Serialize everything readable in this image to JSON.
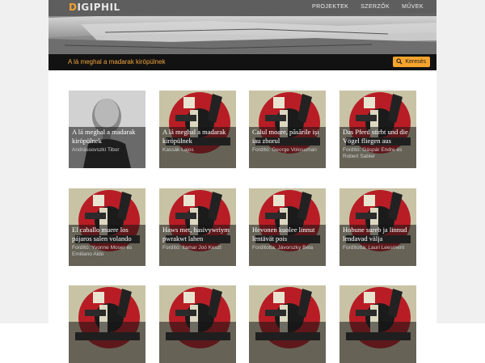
{
  "header": {
    "logo_accent": "D",
    "logo_rest": "IGIPHIL",
    "nav": [
      "PROJEKTEK",
      "SZERZŐK",
      "MŰVEK"
    ]
  },
  "titlebar": {
    "title": "A lá meghal a madarak kiröpülnek",
    "search_label": "Keresés"
  },
  "cards": [
    {
      "title": "A lá meghal a madarak kiröpülnek",
      "author": "Andrássovszkí Tibor",
      "image": "portrait-photo"
    },
    {
      "title": "A lá meghal a madarak kiröpülnek",
      "author": "Kassák Lajos",
      "image": "red-circle-poster"
    },
    {
      "title": "Calul moare, păsările iși iau zborul",
      "author": "Fordító: George Volosuman",
      "image": "red-circle-poster"
    },
    {
      "title": "Das Pferd stirbt und die Vögel fliegen aus",
      "author": "Fordító: Gáspár Endre és Robert Sabler",
      "image": "red-circle-poster"
    },
    {
      "title": "El caballo muere los pájaros salen volando",
      "author": "Fordító: Yvonne Moser és Emiliano Aldo",
      "image": "red-circle-poster"
    },
    {
      "title": "Haws met, hasivywriym pwrakwt lahen",
      "author": "Fordító: Itamar Joó Keszt",
      "image": "red-circle-poster"
    },
    {
      "title": "Hevonen kuolee linnut lentävät pois",
      "author": "Fordította: Jávorszky Béla",
      "image": "red-circle-poster"
    },
    {
      "title": "Hobune sureb ja linnud lendavad välja",
      "author": "Fordította: Lauri Leesment",
      "image": "red-circle-poster"
    },
    {
      "title": "",
      "author": "",
      "image": "red-circle-poster"
    },
    {
      "title": "",
      "author": "",
      "image": "red-circle-poster"
    },
    {
      "title": "",
      "author": "",
      "image": "red-circle-poster"
    },
    {
      "title": "",
      "author": "",
      "image": "red-circle-poster"
    }
  ]
}
